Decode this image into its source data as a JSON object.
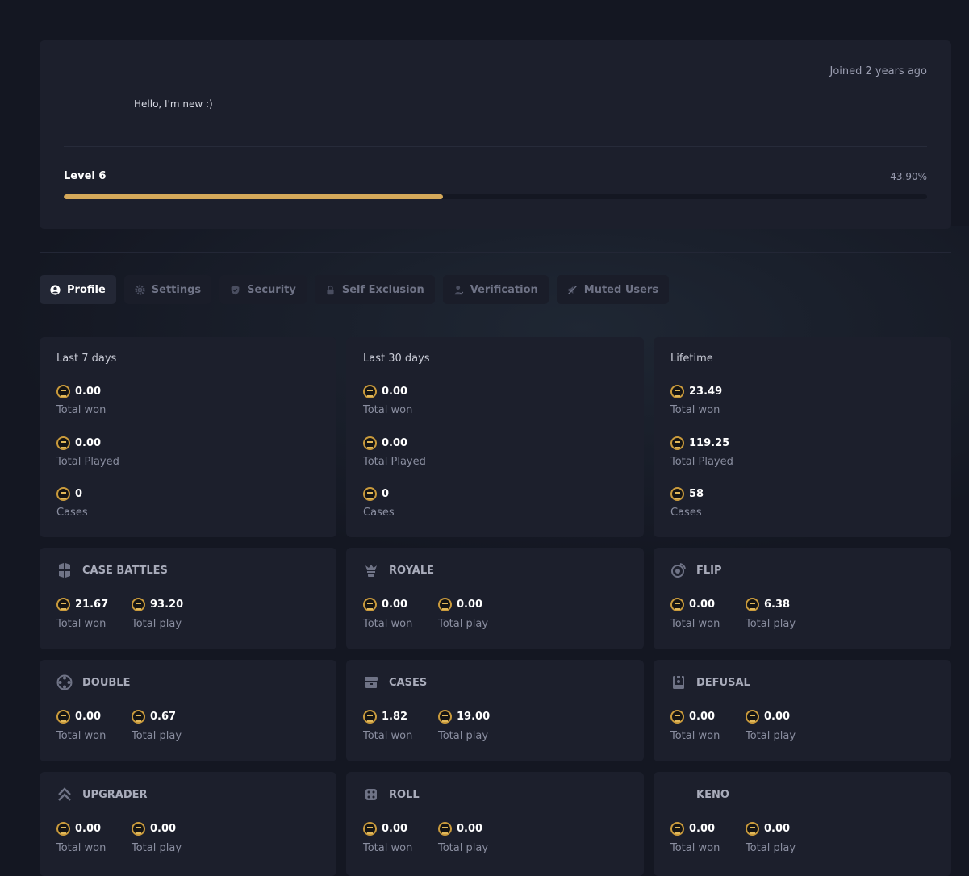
{
  "profile": {
    "joined": "Joined 2 years ago",
    "bio": "Hello, I'm new :)",
    "level_label": "Level 6",
    "level_percent_text": "43.90%",
    "level_progress": 43.9,
    "accent_color": "#d4a85a"
  },
  "tabs": [
    {
      "label": "Profile",
      "icon": "user-icon",
      "active": true
    },
    {
      "label": "Settings",
      "icon": "gear-icon",
      "active": false
    },
    {
      "label": "Security",
      "icon": "shield-icon",
      "active": false
    },
    {
      "label": "Self Exclusion",
      "icon": "lock-icon",
      "active": false
    },
    {
      "label": "Verification",
      "icon": "user-check-icon",
      "active": false
    },
    {
      "label": "Muted Users",
      "icon": "mute-icon",
      "active": false
    }
  ],
  "periods": [
    {
      "title": "Last 7 days",
      "won": "0.00",
      "won_label": "Total won",
      "played": "0.00",
      "played_label": "Total Played",
      "cases": "0",
      "cases_label": "Cases"
    },
    {
      "title": "Last 30 days",
      "won": "0.00",
      "won_label": "Total won",
      "played": "0.00",
      "played_label": "Total Played",
      "cases": "0",
      "cases_label": "Cases"
    },
    {
      "title": "Lifetime",
      "won": "23.49",
      "won_label": "Total won",
      "played": "119.25",
      "played_label": "Total Played",
      "cases": "58",
      "cases_label": "Cases"
    }
  ],
  "games": [
    {
      "name": "CASE BATTLES",
      "icon": "case-battles-icon",
      "won": "21.67",
      "play": "93.20",
      "won_label": "Total won",
      "play_label": "Total play"
    },
    {
      "name": "ROYALE",
      "icon": "royale-icon",
      "won": "0.00",
      "play": "0.00",
      "won_label": "Total won",
      "play_label": "Total play"
    },
    {
      "name": "FLIP",
      "icon": "flip-icon",
      "won": "0.00",
      "play": "6.38",
      "won_label": "Total won",
      "play_label": "Total play"
    },
    {
      "name": "DOUBLE",
      "icon": "double-icon",
      "won": "0.00",
      "play": "0.67",
      "won_label": "Total won",
      "play_label": "Total play"
    },
    {
      "name": "CASES",
      "icon": "cases-icon",
      "won": "1.82",
      "play": "19.00",
      "won_label": "Total won",
      "play_label": "Total play"
    },
    {
      "name": "DEFUSAL",
      "icon": "defusal-icon",
      "won": "0.00",
      "play": "0.00",
      "won_label": "Total won",
      "play_label": "Total play"
    },
    {
      "name": "UPGRADER",
      "icon": "upgrader-icon",
      "won": "0.00",
      "play": "0.00",
      "won_label": "Total won",
      "play_label": "Total play"
    },
    {
      "name": "ROLL",
      "icon": "dice-icon",
      "won": "0.00",
      "play": "0.00",
      "won_label": "Total won",
      "play_label": "Total play"
    },
    {
      "name": "KENO",
      "icon": "",
      "won": "0.00",
      "play": "0.00",
      "won_label": "Total won",
      "play_label": "Total play"
    }
  ]
}
